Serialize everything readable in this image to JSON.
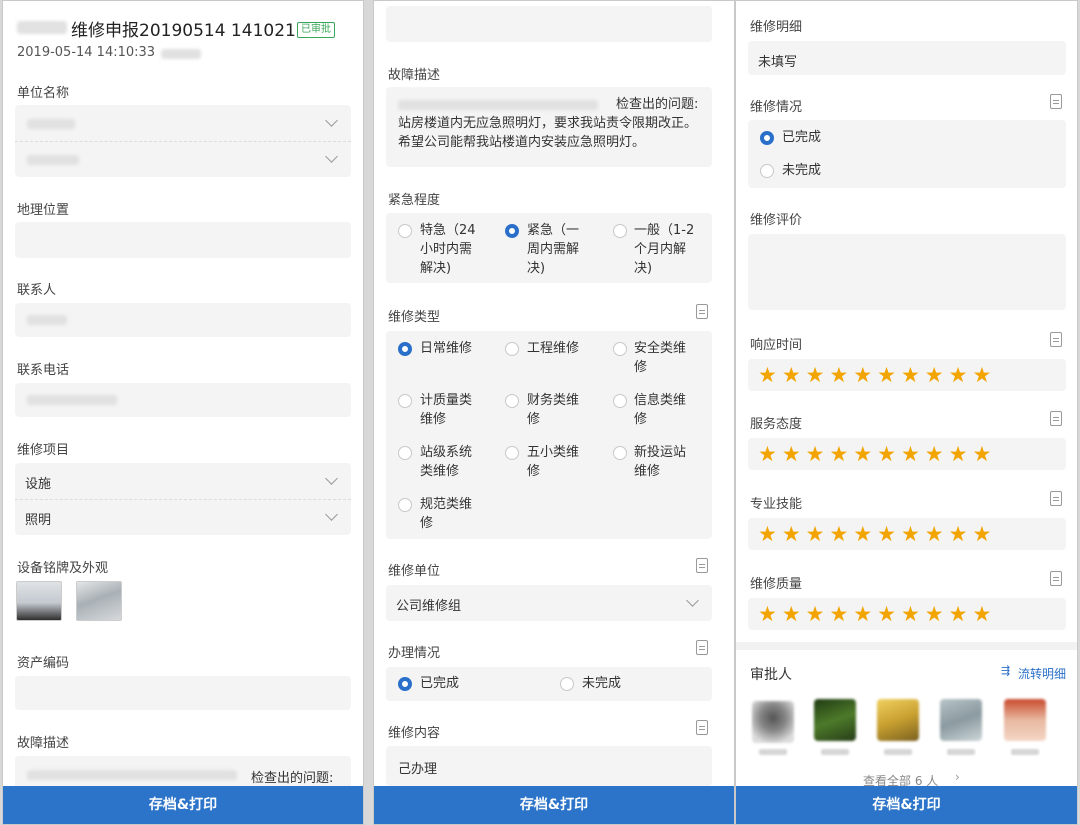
{
  "panel1": {
    "title": "维修申报20190514 141021",
    "status_badge": "已审批",
    "datetime": "2019-05-14 14:10:33",
    "unit_label": "单位名称",
    "location_label": "地理位置",
    "contact_label": "联系人",
    "phone_label": "联系电话",
    "item_label": "维修项目",
    "item_select_1": "设施",
    "item_select_2": "照明",
    "nameplate_label": "设备铭牌及外观",
    "asset_label": "资产编码",
    "fault_label": "故障描述",
    "fault_text_partial": "检查出的问题:"
  },
  "panel2": {
    "fault_label": "故障描述",
    "fault_text": "检查出的问题:\n站房楼道内无应急照明灯，要求我站责令限期改正。希望公司能帮我站楼道内安装应急照明灯。",
    "urgency_label": "紧急程度",
    "urgency_options": [
      "特急（24小时内需解决)",
      "紧急（一周内需解决)",
      "一般（1-2个月内解决)"
    ],
    "urgency_selected": 1,
    "type_label": "维修类型",
    "type_options": [
      "日常维修",
      "工程维修",
      "安全类维修",
      "计质量类维修",
      "财务类维修",
      "信息类维修",
      "站级系统类维修",
      "五小类维修",
      "新投运站维修",
      "规范类维修"
    ],
    "type_selected": 0,
    "unit_label": "维修单位",
    "unit_value": "公司维修组",
    "handling_label": "办理情况",
    "handling_options": [
      "已完成",
      "未完成"
    ],
    "handling_selected": 0,
    "content_label": "维修内容",
    "content_value": "己办理"
  },
  "panel3": {
    "detail_label": "维修明细",
    "detail_value": "未填写",
    "status_label": "维修情况",
    "status_options": [
      "已完成",
      "未完成"
    ],
    "status_selected": 0,
    "eval_label": "维修评价",
    "ratings": [
      {
        "label": "响应时间",
        "stars": 10
      },
      {
        "label": "服务态度",
        "stars": 10
      },
      {
        "label": "专业技能",
        "stars": 10
      },
      {
        "label": "维修质量",
        "stars": 10
      }
    ],
    "approver_label": "审批人",
    "flow_link": "流转明细",
    "view_all": "查看全部 6 人"
  },
  "footer_button": "存档&打印",
  "icons": [
    "chevron-down-icon",
    "document-icon",
    "flow-icon",
    "chevron-right-icon"
  ],
  "colors": {
    "accent": "#2b74c9",
    "star": "#f2a400",
    "approved": "#3aa65a"
  }
}
